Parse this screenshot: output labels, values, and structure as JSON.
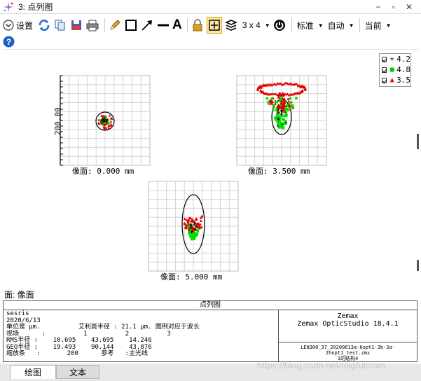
{
  "window": {
    "title": "3: 点列图",
    "minimize": "−",
    "restore": "▫",
    "close": "✕"
  },
  "toolbar": {
    "settings_label": "设置",
    "layout_label": "3 x 4",
    "standard_label": "标准",
    "auto_label": "自动",
    "current_label": "当前",
    "text_tool_label": "A"
  },
  "legend": [
    {
      "marker": "+",
      "value": "4.2",
      "color": "#000000"
    },
    {
      "marker": "■",
      "value": "4.8",
      "color": "#00cc00"
    },
    {
      "marker": "▲",
      "value": "3.5",
      "color": "#dd0000"
    }
  ],
  "plots": [
    {
      "label": "像面: 0.000 mm"
    },
    {
      "label": "像面: 3.500 mm"
    },
    {
      "label": "像面: 5.000 mm"
    }
  ],
  "y_axis_label": "200.00",
  "surface_label": "面: 像面",
  "info": {
    "title": "点列图",
    "lines": [
      "sesris",
      "2020/6/13",
      "单位是 μm.          艾利斑半径 : 21.1 μm. 图例对应于波长",
      "视场      :          1          2          3",
      "RMS半径 :    10.695    43.695    14.246",
      "GEO半径 :    19.493    90.144    43.876",
      "缩放条   :       200      参考   :主光线"
    ],
    "brand_1": "Zemax",
    "brand_2": "Zemax OpticStudio 18.4.1",
    "file_name": "LEN300_37_20200613a-6opt1-3b-3a-2hopt1_test.zmx",
    "config": "1的结构4"
  },
  "tabs": {
    "plot": "绘图",
    "text": "文本"
  },
  "watermark": "https://blog.csdn.net/migfulcrum"
}
